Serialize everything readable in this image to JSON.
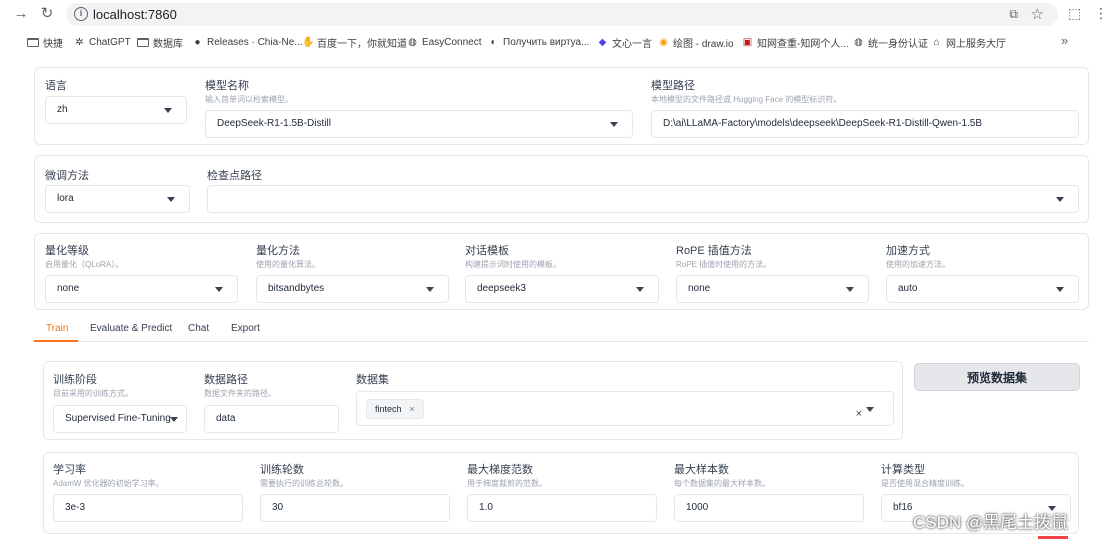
{
  "browser": {
    "url": "localhost:7860",
    "bookmarks": [
      {
        "label": "快捷",
        "icon": "folder-icon"
      },
      {
        "label": "ChatGPT",
        "icon": "chatgpt-icon"
      },
      {
        "label": "数据库",
        "icon": "folder-icon"
      },
      {
        "label": "Releases · Chia-Ne...",
        "icon": "github-icon"
      },
      {
        "label": "百度一下，你就知道",
        "icon": "baidu-icon"
      },
      {
        "label": "EasyConnect",
        "icon": "globe-icon"
      },
      {
        "label": "Получить виртуа...",
        "icon": "site-icon"
      },
      {
        "label": "文心一言",
        "icon": "wenxin-icon"
      },
      {
        "label": "绘图 - draw.io",
        "icon": "drawio-icon"
      },
      {
        "label": "知网查重-知网个人...",
        "icon": "cnki-icon"
      },
      {
        "label": "统一身份认证",
        "icon": "globe-icon"
      },
      {
        "label": "网上服务大厅",
        "icon": "home-icon"
      }
    ],
    "more": "»"
  },
  "top": {
    "lang_label": "语言",
    "lang_value": "zh",
    "model_name_label": "模型名称",
    "model_name_hint": "输入首单词以检索模型。",
    "model_name_value": "DeepSeek-R1-1.5B-Distill",
    "model_path_label": "模型路径",
    "model_path_hint": "本地模型的文件路径或 Hugging Face 的模型标识符。",
    "model_path_value": "D:\\ai\\LLaMA-Factory\\models\\deepseek\\DeepSeek-R1-Distill-Qwen-1.5B"
  },
  "finetune": {
    "method_label": "微调方法",
    "method_value": "lora",
    "checkpoint_label": "检查点路径",
    "checkpoint_value": ""
  },
  "quant": {
    "level_label": "量化等级",
    "level_hint": "启用量化（QLoRA）。",
    "level_value": "none",
    "method_label": "量化方法",
    "method_hint": "使用的量化算法。",
    "method_value": "bitsandbytes",
    "template_label": "对话模板",
    "template_hint": "构建提示词时使用的模板。",
    "template_value": "deepseek3",
    "rope_label": "RoPE 插值方法",
    "rope_hint": "RoPE 插值时使用的方法。",
    "rope_value": "none",
    "accel_label": "加速方式",
    "accel_hint": "使用的加速方法。",
    "accel_value": "auto"
  },
  "tabs": [
    "Train",
    "Evaluate & Predict",
    "Chat",
    "Export"
  ],
  "train": {
    "stage_label": "训练阶段",
    "stage_hint": "目前采用的训练方式。",
    "stage_value": "Supervised Fine-Tuning",
    "data_dir_label": "数据路径",
    "data_dir_hint": "数据文件夹的路径。",
    "data_dir_value": "data",
    "dataset_label": "数据集",
    "dataset_chip": "fintech",
    "chip_remove": "×",
    "clear_glyph": "×",
    "preview_button": "预览数据集"
  },
  "hyper": {
    "lr_label": "学习率",
    "lr_hint": "AdamW 优化器的初始学习率。",
    "lr_value": "3e-3",
    "epochs_label": "训练轮数",
    "epochs_hint": "需要执行的训练总轮数。",
    "epochs_value": "30",
    "grad_label": "最大梯度范数",
    "grad_hint": "用于梯度裁剪的范数。",
    "grad_value": "1.0",
    "samples_label": "最大样本数",
    "samples_hint": "每个数据集的最大样本数。",
    "samples_value": "1000",
    "compute_label": "计算类型",
    "compute_hint": "是否使用混合精度训练。",
    "compute_value": "bf16"
  },
  "watermark": "CSDN @黑尾土拨鼠"
}
